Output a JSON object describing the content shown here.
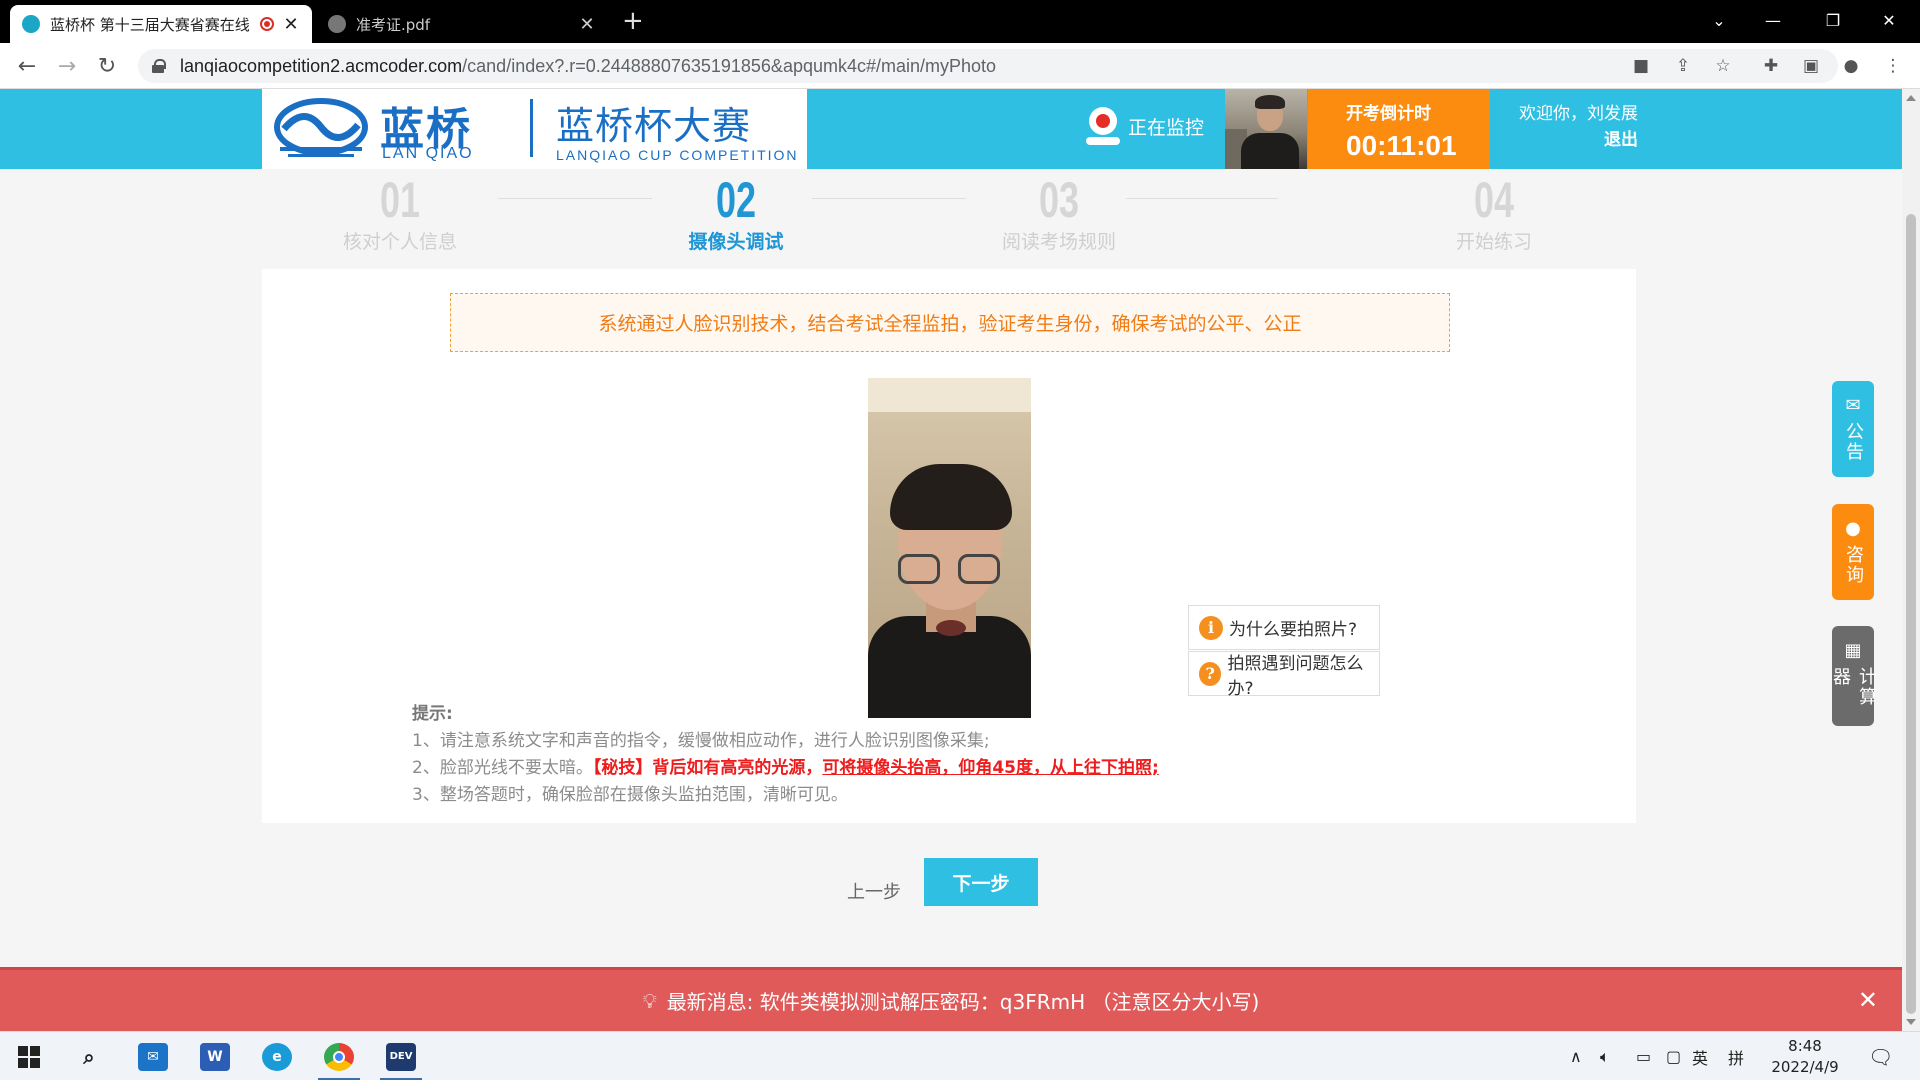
{
  "browser": {
    "tabs": [
      {
        "title": "蓝桥杯 第十三届大赛省赛在线",
        "active": true
      },
      {
        "title": "准考证.pdf",
        "active": false
      }
    ],
    "url_host": "lanqiaocompetition2.acmcoder.com",
    "url_path": "/cand/index?.r=0.24488807635191856&apqumk4c#/main/myPhoto"
  },
  "header": {
    "logo_cn": "蓝桥",
    "logo_en": "LAN QIAO",
    "logo_cn2": "蓝桥杯大赛",
    "logo_en2": "LANQIAO CUP COMPETITION",
    "monitor_label": "正在监控",
    "countdown_label": "开考倒计时",
    "countdown_time": "00:11:01",
    "welcome": "欢迎你，刘发展",
    "logout": "退出",
    "colors": {
      "primary": "#2fbfe3",
      "countdown": "#fc8c10"
    }
  },
  "steps": [
    {
      "num": "01",
      "label": "核对个人信息",
      "active": false
    },
    {
      "num": "02",
      "label": "摄像头调试",
      "active": true
    },
    {
      "num": "03",
      "label": "阅读考场规则",
      "active": false
    },
    {
      "num": "04",
      "label": "开始练习",
      "active": false
    }
  ],
  "content": {
    "notice": "系统通过人脸识别技术，结合考试全程监拍，验证考生身份，确保考试的公平、公正",
    "tips_title": "提示:",
    "tip1": "1、请注意系统文字和声音的指令，缓慢做相应动作，进行人脸识别图像采集;",
    "tip2_prefix": "2、脸部光线不要太暗。",
    "tip2_red": "【秘技】背后如有高亮的光源，",
    "tip2_red_underline": "可将摄像头抬高，仰角45度，从上往下拍照;",
    "tip3": "3、整场答题时，确保脸部在摄像头监拍范围，清晰可见。",
    "help_why": "为什么要拍照片?",
    "help_problem": "拍照遇到问题怎么办?",
    "prev_label": "上一步",
    "next_label": "下一步"
  },
  "side": [
    {
      "label": "公告",
      "color": "#2fbfe3",
      "icon": "mail-icon"
    },
    {
      "label": "咨询",
      "color": "#fc8c10",
      "icon": "chat-icon"
    },
    {
      "label": "计算器",
      "color": "#6b6b6b",
      "icon": "calculator-icon"
    }
  ],
  "news": {
    "text": "最新消息: 软件类模拟测试解压密码：q3FRmH （注意区分大小写)"
  },
  "taskbar": {
    "ime1": "英",
    "ime2": "拼",
    "time": "8:48",
    "date": "2022/4/9"
  }
}
